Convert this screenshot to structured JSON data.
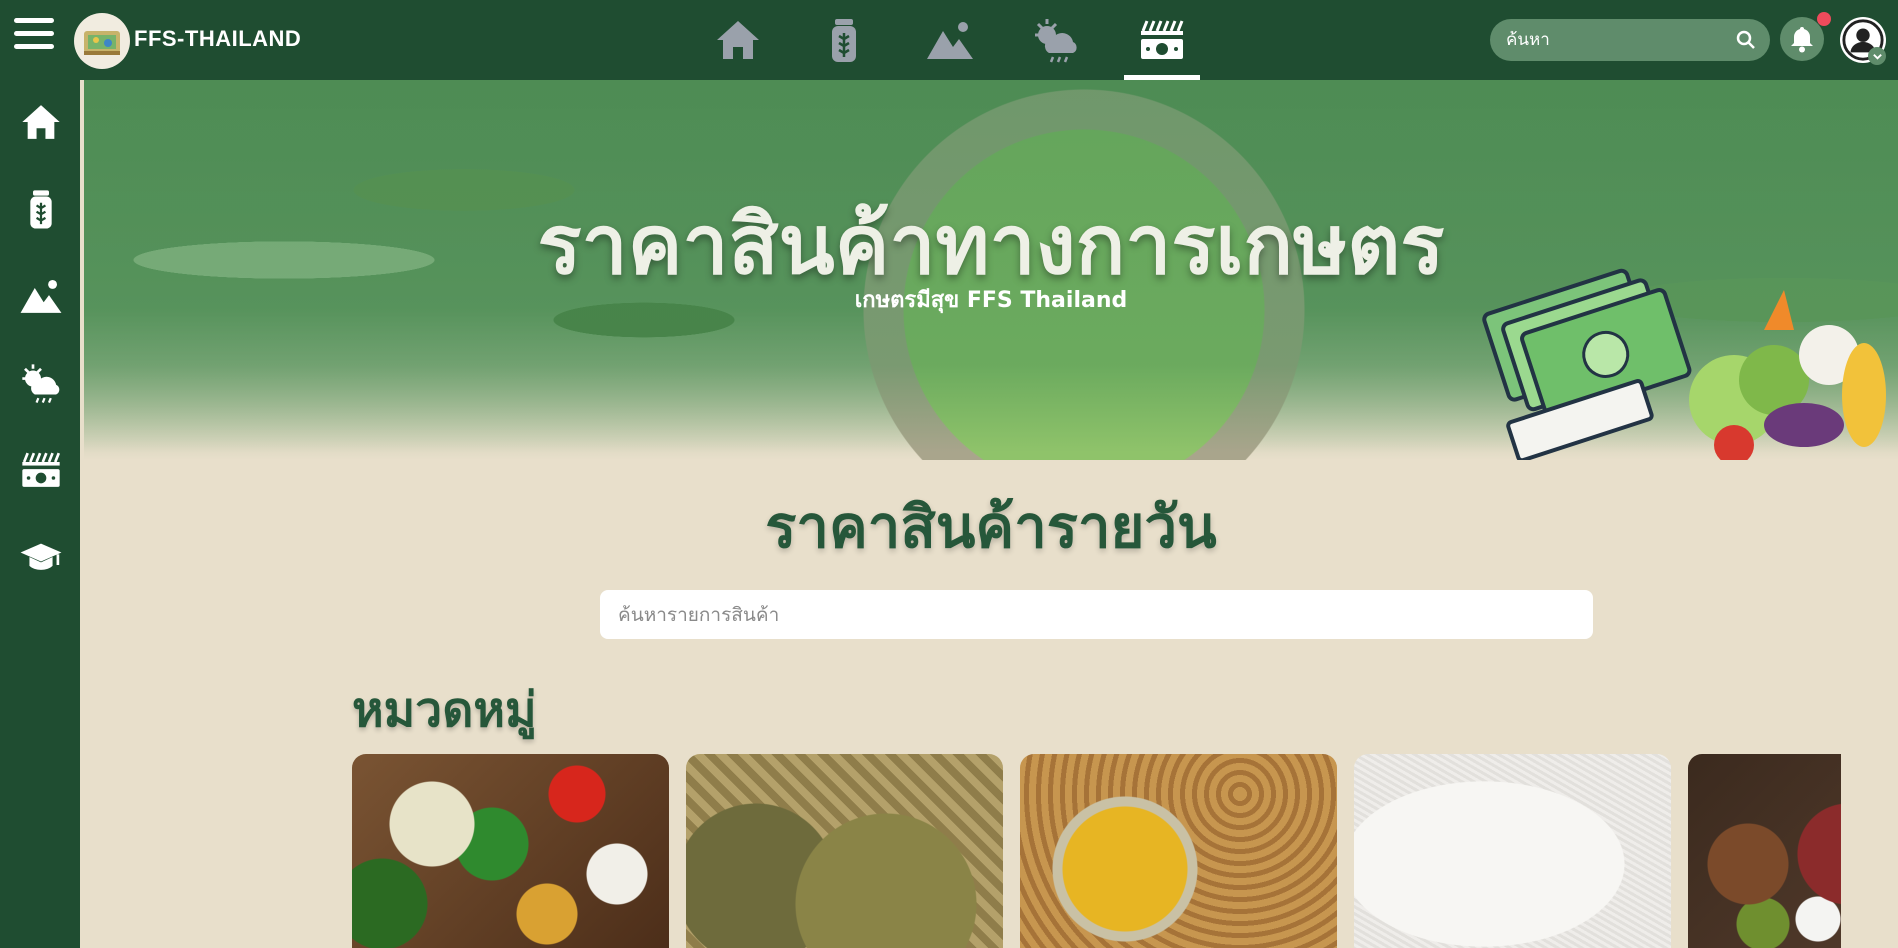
{
  "app": {
    "brand": "FFS-THAILAND"
  },
  "topnav": {
    "items": [
      {
        "icon": "home-icon",
        "active": false
      },
      {
        "icon": "seed-jar-icon",
        "active": false
      },
      {
        "icon": "land-icon",
        "active": false
      },
      {
        "icon": "weather-icon",
        "active": false
      },
      {
        "icon": "market-price-icon",
        "active": true
      }
    ]
  },
  "search": {
    "placeholder": "ค้นหา"
  },
  "notifications": {
    "has_unread": true
  },
  "sidebar": {
    "items": [
      {
        "icon": "home-icon"
      },
      {
        "icon": "seed-jar-icon"
      },
      {
        "icon": "land-icon"
      },
      {
        "icon": "weather-icon"
      },
      {
        "icon": "market-price-icon"
      },
      {
        "icon": "graduation-cap-icon"
      }
    ]
  },
  "hero": {
    "title": "ราคาสินค้าทางการเกษตร",
    "subtitle": "เกษตรมีสุข FFS Thailand"
  },
  "daily": {
    "title": "ราคาสินค้ารายวัน",
    "search_placeholder": "ค้นหารายการสินค้า"
  },
  "categories": {
    "title": "หมวดหมู่",
    "cards": [
      {
        "image": "vegetables-spices-photo"
      },
      {
        "image": "durian-photo"
      },
      {
        "image": "oil-soybeans-photo"
      },
      {
        "image": "rice-photo"
      },
      {
        "image": "meat-grains-photo"
      }
    ]
  },
  "colors": {
    "nav_bg": "#1f4d31",
    "page_bg": "#e8dfcb",
    "heading_green": "#26573a",
    "pill_green": "#5f8c6b",
    "alert_red": "#ee4b5c"
  }
}
